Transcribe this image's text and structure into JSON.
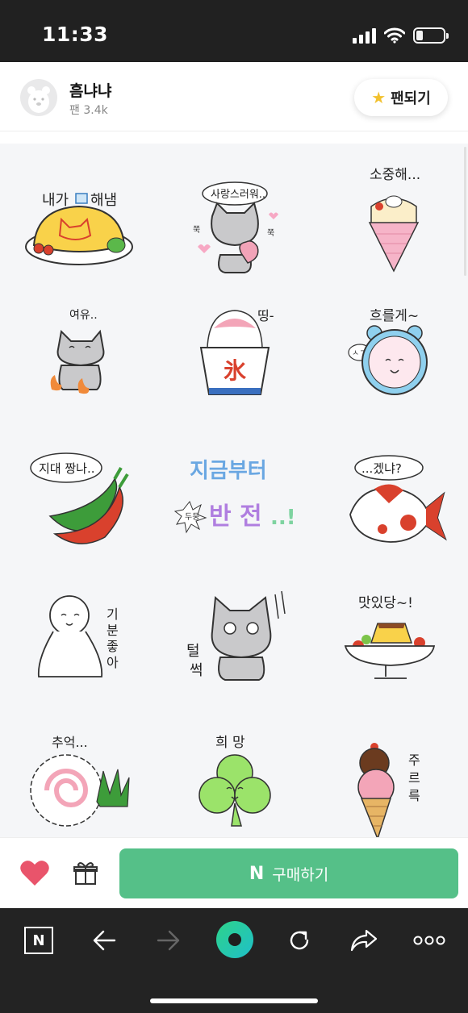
{
  "status_bar": {
    "time": "11:33"
  },
  "header": {
    "author_name": "흠냐냐",
    "fan_count": "팬 3.4k",
    "fan_button_label": "팬되기"
  },
  "stickers": [
    {
      "id": "s1",
      "texts": [
        "내가",
        "해냄"
      ]
    },
    {
      "id": "s2",
      "texts": [
        "사랑스러워..",
        "쭉",
        "쭉"
      ]
    },
    {
      "id": "s3",
      "texts": [
        "소중해..."
      ]
    },
    {
      "id": "s4",
      "texts": [
        "여유.."
      ]
    },
    {
      "id": "s5",
      "texts": [
        "띵-",
        "氷"
      ]
    },
    {
      "id": "s6",
      "texts": [
        "흐를게~",
        "ㅅㄱ"
      ]
    },
    {
      "id": "s7",
      "texts": [
        "지대 짱나.."
      ]
    },
    {
      "id": "s8",
      "texts": [
        "지금부터",
        "두둥",
        "반 전",
        "..!"
      ]
    },
    {
      "id": "s9",
      "texts": [
        "...겠냐?"
      ]
    },
    {
      "id": "s10",
      "texts": [
        "기",
        "분",
        "좋",
        "아"
      ]
    },
    {
      "id": "s11",
      "texts": [
        "털",
        "썩"
      ]
    },
    {
      "id": "s12",
      "texts": [
        "맛있당~!"
      ]
    },
    {
      "id": "s13",
      "texts": [
        "추억..."
      ]
    },
    {
      "id": "s14",
      "texts": [
        "희 망"
      ]
    },
    {
      "id": "s15",
      "texts": [
        "주",
        "르",
        "륵"
      ]
    }
  ],
  "purchase": {
    "buy_label": "구매하기",
    "logo": "N"
  },
  "toolbar": {
    "icons": [
      "naver-n-icon",
      "back-icon",
      "forward-icon",
      "green-dot-icon",
      "refresh-icon",
      "share-icon",
      "more-icon"
    ],
    "n_label": "N"
  },
  "colors": {
    "buy_green": "#55c088",
    "heart": "#e9546b",
    "toolbar_bg": "#232323",
    "status_bg": "#212121"
  }
}
